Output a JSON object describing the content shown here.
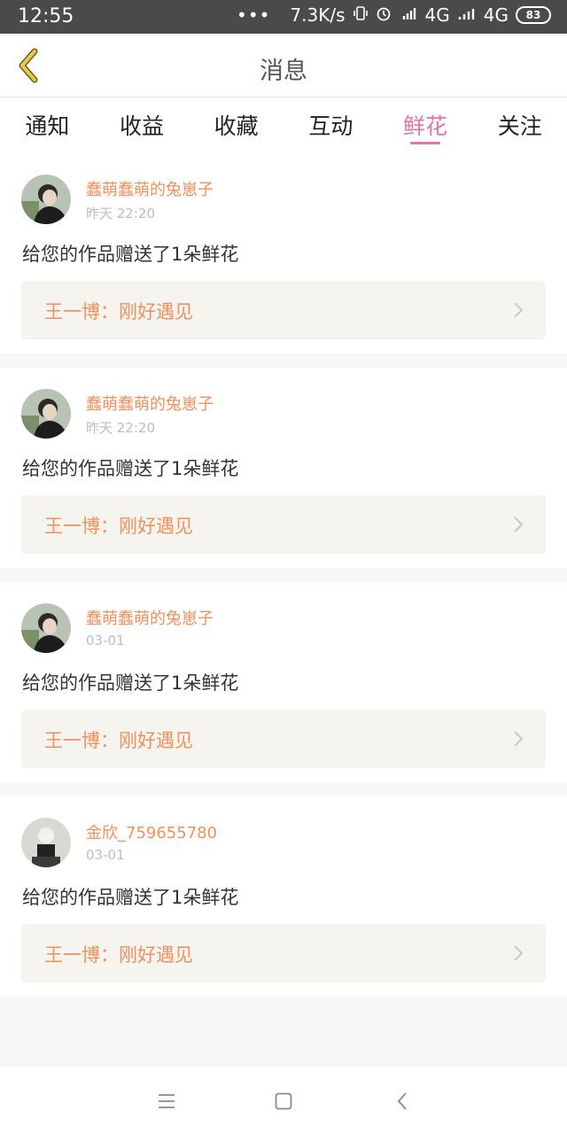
{
  "status_bar": {
    "time": "12:55",
    "dots": "•••",
    "speed": "7.3K/s",
    "network1": "4G",
    "network2": "4G",
    "battery": "83"
  },
  "header": {
    "title": "消息"
  },
  "tabs": [
    {
      "label": "通知"
    },
    {
      "label": "收益"
    },
    {
      "label": "收藏"
    },
    {
      "label": "互动"
    },
    {
      "label": "鲜花"
    },
    {
      "label": "关注"
    }
  ],
  "active_tab": "鲜花",
  "messages": [
    {
      "username": "蠢萌蠢萌的兔崽子",
      "time": "昨天 22:20",
      "text": "给您的作品赠送了1朵鲜花",
      "work": "王一博：刚好遇见"
    },
    {
      "username": "蠢萌蠢萌的兔崽子",
      "time": "昨天 22:20",
      "text": "给您的作品赠送了1朵鲜花",
      "work": "王一博：刚好遇见"
    },
    {
      "username": "蠢萌蠢萌的兔崽子",
      "time": "03-01",
      "text": "给您的作品赠送了1朵鲜花",
      "work": "王一博：刚好遇见"
    },
    {
      "username": "金欣_759655780",
      "time": "03-01",
      "text": "给您的作品赠送了1朵鲜花",
      "work": "王一博：刚好遇见"
    }
  ],
  "colors": {
    "accent_pink": "#e274a6",
    "accent_orange": "#f0915d",
    "back_arrow": "#e6c94a"
  }
}
